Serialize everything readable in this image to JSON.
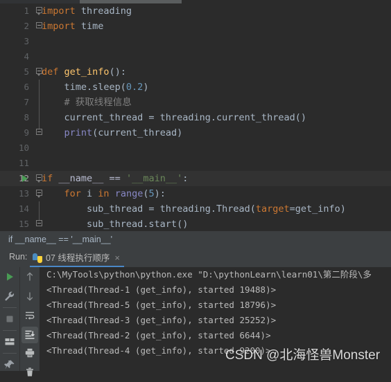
{
  "window": {
    "app": "PyCharm",
    "theme_colors": {
      "editor_bg": "#2b2b2b",
      "panel_bg": "#3c3f41",
      "current_line_bg": "#323232",
      "line_number": "#606366",
      "default_text": "#a9b7c6",
      "keyword": "#cc7832",
      "string": "#6a8759",
      "number": "#6897bb",
      "comment": "#808080",
      "function": "#ffc66d",
      "builtin": "#8888c6",
      "tab_accent": "#4a88c7",
      "run_green": "#499c54"
    }
  },
  "editor": {
    "lines": [
      {
        "num": "1",
        "fold": "region-start",
        "gutter_run": false,
        "current": false,
        "tokens": [
          {
            "t": "import",
            "c": "kw"
          },
          {
            "t": " threading",
            "c": "id"
          }
        ]
      },
      {
        "num": "2",
        "fold": "box-plain",
        "gutter_run": false,
        "current": false,
        "tokens": [
          {
            "t": "import",
            "c": "kw"
          },
          {
            "t": " time",
            "c": "id"
          }
        ]
      },
      {
        "num": "3",
        "fold": "none",
        "gutter_run": false,
        "current": false,
        "tokens": []
      },
      {
        "num": "4",
        "fold": "none",
        "gutter_run": false,
        "current": false,
        "tokens": []
      },
      {
        "num": "5",
        "fold": "region-start",
        "gutter_run": false,
        "current": false,
        "tokens": [
          {
            "t": "def",
            "c": "kw"
          },
          {
            "t": " ",
            "c": "id"
          },
          {
            "t": "get_info",
            "c": "fn"
          },
          {
            "t": "():",
            "c": "id"
          }
        ]
      },
      {
        "num": "6",
        "fold": "line",
        "gutter_run": false,
        "current": false,
        "tokens": [
          {
            "t": "    time.sleep(",
            "c": "id"
          },
          {
            "t": "0.2",
            "c": "num"
          },
          {
            "t": ")",
            "c": "id"
          }
        ]
      },
      {
        "num": "7",
        "fold": "line",
        "gutter_run": false,
        "current": false,
        "tokens": [
          {
            "t": "    # 获取线程信息",
            "c": "cmt"
          }
        ]
      },
      {
        "num": "8",
        "fold": "line",
        "gutter_run": false,
        "current": false,
        "tokens": [
          {
            "t": "    current_thread = threading.current_thread()",
            "c": "id"
          }
        ]
      },
      {
        "num": "9",
        "fold": "region-end",
        "gutter_run": false,
        "current": false,
        "tokens": [
          {
            "t": "    ",
            "c": "id"
          },
          {
            "t": "print",
            "c": "bi"
          },
          {
            "t": "(current_thread)",
            "c": "id"
          }
        ]
      },
      {
        "num": "10",
        "fold": "none",
        "gutter_run": false,
        "current": false,
        "tokens": []
      },
      {
        "num": "11",
        "fold": "none",
        "gutter_run": false,
        "current": false,
        "tokens": []
      },
      {
        "num": "12",
        "fold": "region-start",
        "gutter_run": true,
        "current": true,
        "tokens": [
          {
            "t": "if",
            "c": "kw"
          },
          {
            "t": " __name__ == ",
            "c": "dund"
          },
          {
            "t": "'__main__'",
            "c": "str"
          },
          {
            "t": ":",
            "c": "id"
          }
        ]
      },
      {
        "num": "13",
        "fold": "region-start-mid",
        "gutter_run": false,
        "current": false,
        "tokens": [
          {
            "t": "    ",
            "c": "id"
          },
          {
            "t": "for",
            "c": "kw"
          },
          {
            "t": " i ",
            "c": "id"
          },
          {
            "t": "in",
            "c": "kw"
          },
          {
            "t": " ",
            "c": "id"
          },
          {
            "t": "range",
            "c": "bi"
          },
          {
            "t": "(",
            "c": "id"
          },
          {
            "t": "5",
            "c": "num"
          },
          {
            "t": "):",
            "c": "id"
          }
        ]
      },
      {
        "num": "14",
        "fold": "line",
        "gutter_run": false,
        "current": false,
        "tokens": [
          {
            "t": "        sub_thread = threading.Thread(",
            "c": "id"
          },
          {
            "t": "target",
            "c": "param"
          },
          {
            "t": "=get_info)",
            "c": "id"
          }
        ]
      },
      {
        "num": "15",
        "fold": "region-end",
        "gutter_run": false,
        "current": false,
        "tokens": [
          {
            "t": "        sub_thread.start()",
            "c": "id"
          }
        ]
      }
    ]
  },
  "breadcrumb": {
    "text": "if __name__ == '__main__'"
  },
  "run_window": {
    "label": "Run:",
    "tab": {
      "icon": "python-file-icon",
      "title": "07 线程执行顺序",
      "close": "×"
    },
    "toolbar_left": [
      {
        "name": "rerun-button",
        "icon": "play-green-icon"
      },
      {
        "name": "modify-run-configuration-button",
        "icon": "wrench-icon"
      },
      {
        "name": "stop-button",
        "icon": "stop-square-icon"
      },
      {
        "name": "restore-layout-button",
        "icon": "layout-icon"
      },
      {
        "name": "pin-tab-button",
        "icon": "pin-icon"
      }
    ],
    "toolbar_right": [
      {
        "name": "up-the-stack-trace-button",
        "icon": "arrow-up-icon",
        "selected": false
      },
      {
        "name": "down-the-stack-trace-button",
        "icon": "arrow-down-icon",
        "selected": false
      },
      {
        "name": "soft-wrap-button",
        "icon": "soft-wrap-icon",
        "selected": false
      },
      {
        "name": "scroll-to-end-button",
        "icon": "scroll-end-icon",
        "selected": true
      },
      {
        "name": "print-button",
        "icon": "printer-icon",
        "selected": false
      },
      {
        "name": "clear-all-button",
        "icon": "trash-icon",
        "selected": false
      }
    ],
    "console_lines": [
      "C:\\MyTools\\python\\python.exe \"D:\\pythonLearn\\learn01\\第二阶段\\多",
      "<Thread(Thread-1 (get_info), started 19488)>",
      "<Thread(Thread-5 (get_info), started 18796)>",
      "<Thread(Thread-3 (get_info), started 25252)>",
      "<Thread(Thread-2 (get_info), started 6644)>",
      "<Thread(Thread-4 (get_info), started 9200)>"
    ]
  },
  "watermark": {
    "text": "CSDN @北海怪兽Monster"
  }
}
